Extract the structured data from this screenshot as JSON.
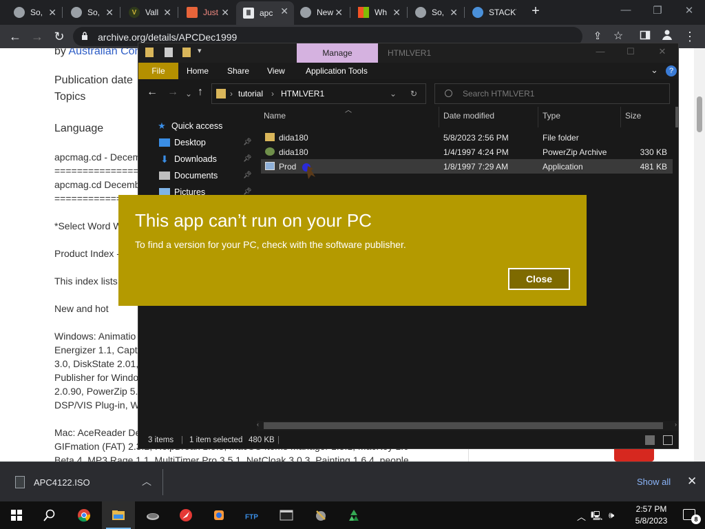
{
  "browser": {
    "tabs": [
      {
        "title": "So,",
        "icon": "globe-icon"
      },
      {
        "title": "So,",
        "icon": "globe-icon"
      },
      {
        "title": "Vall",
        "icon": "vallheru-icon"
      },
      {
        "title": "Just",
        "icon": "flag-icon"
      },
      {
        "title": "apc",
        "icon": "archive-icon"
      },
      {
        "title": "New",
        "icon": "chrome-icon"
      },
      {
        "title": "Wh",
        "icon": "microsoft-icon"
      },
      {
        "title": "So,",
        "icon": "globe-icon"
      },
      {
        "title": "STACKT",
        "icon": "stackt-icon"
      }
    ],
    "new_tab": "+",
    "url": "archive.org/details/APCDec1999"
  },
  "page": {
    "byline_prefix": "by",
    "byline_link": "Australian Con",
    "publication_date_label": "Publication date",
    "topics_label": "Topics",
    "language_label": "Language",
    "lines": [
      "apcmag.cd - Decem",
      "================",
      "apcmag.cd Decemb",
      "================",
      "*Select Word W",
      "Product Index -",
      "This index lists",
      "New and hot",
      "Windows: Animatio",
      "Energizer 1.1, Capt",
      "3.0, DiskState 2.01,",
      "Publisher for Windo",
      "2.0.90, PowerZip 5.",
      "DSP/VIS Plug-in, W",
      "Mac: AceReader De",
      "GIFmation (FAT) 2.3.2, HelpBreak 1.3.3, macOS Items Manager 1.3.1, MacKey 1.0",
      "Beta 4, MP3 Rage 1.1, MultiTimer Pro 3.5.1, NetCloak 3.0.3, Painting 1.6.4, people"
    ]
  },
  "downloads": {
    "file": "APC4122.ISO",
    "show_all": "Show all"
  },
  "explorer": {
    "title_tab": "Manage",
    "window_title": "HTMLVER1",
    "ribbon": [
      "File",
      "Home",
      "Share",
      "View",
      "Application Tools"
    ],
    "breadcrumb": [
      "tutorial",
      "HTMLVER1"
    ],
    "search_placeholder": "Search HTMLVER1",
    "nav": [
      {
        "label": "Quick access",
        "icon": "star-icon"
      },
      {
        "label": "Desktop",
        "icon": "desktop-icon"
      },
      {
        "label": "Downloads",
        "icon": "download-icon"
      },
      {
        "label": "Documents",
        "icon": "documents-icon"
      },
      {
        "label": "Pictures",
        "icon": "pictures-icon"
      }
    ],
    "columns": [
      "Name",
      "Date modified",
      "Type",
      "Size"
    ],
    "rows": [
      {
        "name": "dida180",
        "date": "5/8/2023 2:56 PM",
        "type": "File folder",
        "size": ""
      },
      {
        "name": "dida180",
        "date": "1/4/1997 4:24 PM",
        "type": "PowerZip Archive",
        "size": "330 KB"
      },
      {
        "name": "Prod",
        "date": "1/8/1997 7:29 AM",
        "type": "Application",
        "size": "481 KB"
      }
    ],
    "status": {
      "items": "3 items",
      "selected": "1 item selected",
      "size": "480 KB"
    }
  },
  "dialog": {
    "title": "This app can’t run on your PC",
    "message": "To find a version for your PC, check with the software publisher.",
    "close_label": "Close"
  },
  "taskbar": {
    "time": "2:57 PM",
    "date": "5/8/2023",
    "notification_count": "8"
  },
  "colors": {
    "dialog_bg": "#b49a00",
    "ribbon_file": "#b49000",
    "manage_tab": "#d5b2e0",
    "link": "#2c5cc5"
  }
}
